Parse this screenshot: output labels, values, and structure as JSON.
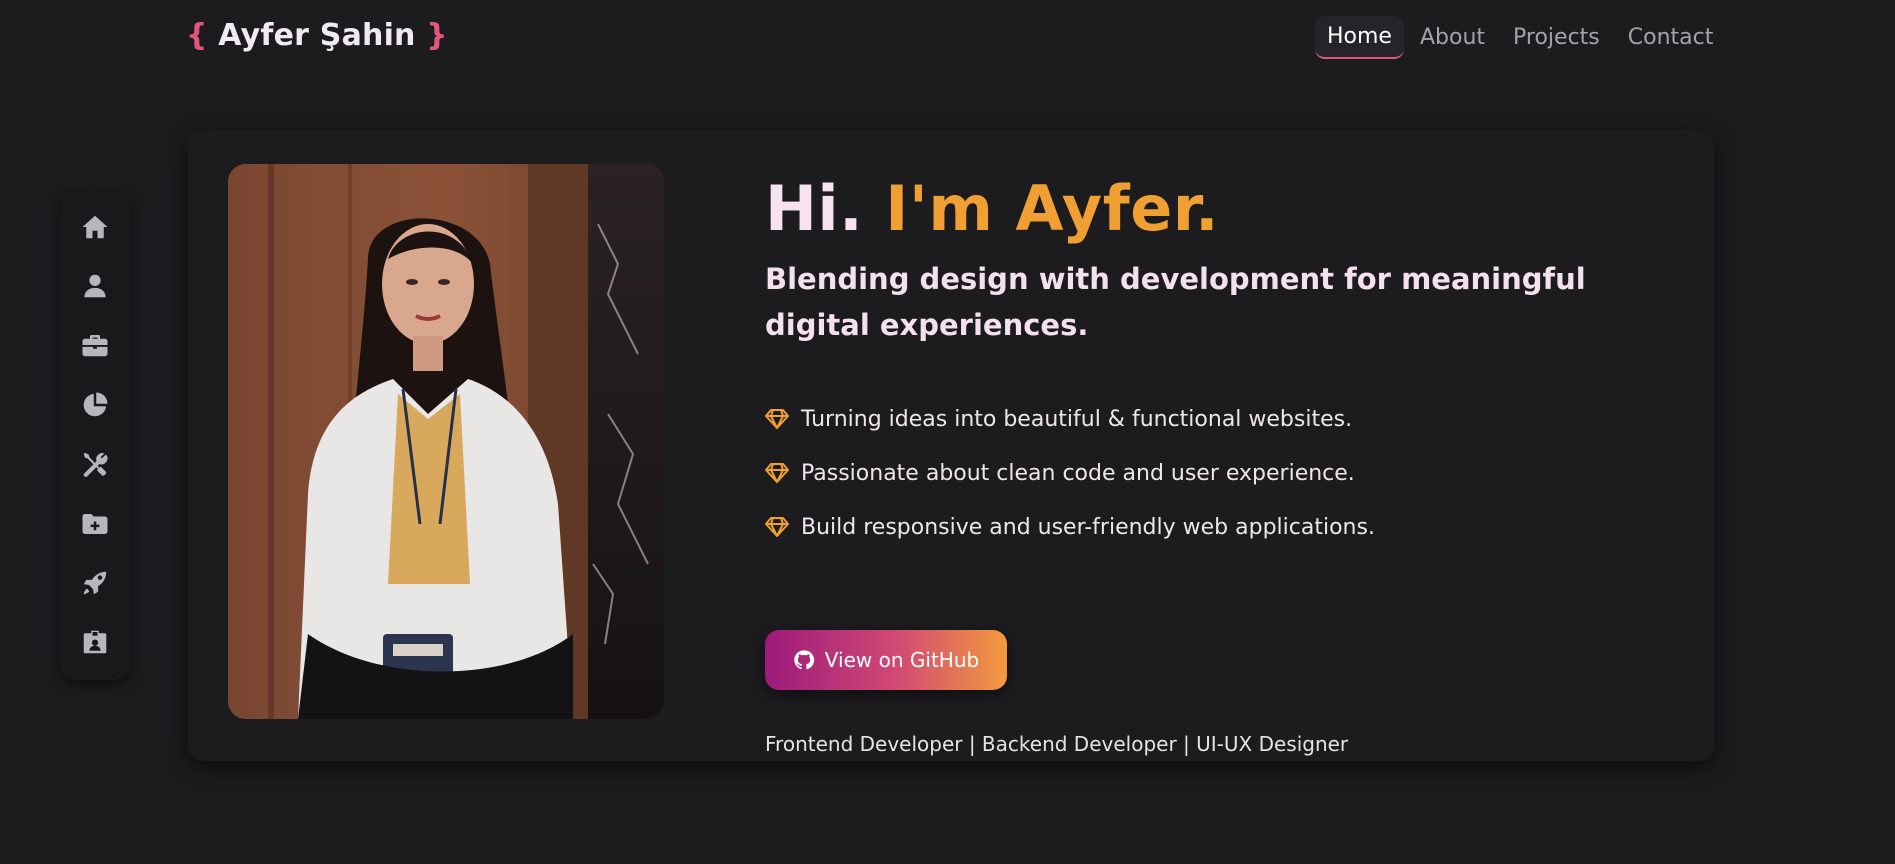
{
  "header": {
    "brand_open": "{",
    "brand_name": "Ayfer Şahin",
    "brand_close": "}",
    "nav": [
      {
        "label": "Home",
        "active": true
      },
      {
        "label": "About",
        "active": false
      },
      {
        "label": "Projects",
        "active": false
      },
      {
        "label": "Contact",
        "active": false
      }
    ]
  },
  "sidebar": {
    "icons": [
      "home-icon",
      "user-icon",
      "briefcase-icon",
      "chart-pie-icon",
      "tools-icon",
      "folder-plus-icon",
      "rocket-icon",
      "id-badge-icon"
    ]
  },
  "hero": {
    "title_prefix": "Hi.",
    "title_accent": "I'm Ayfer.",
    "subtitle": "Blending design with development for meaningful digital experiences.",
    "points": [
      "Turning ideas into beautiful & functional websites.",
      "Passionate about clean code and user experience.",
      "Build responsive and user-friendly web applications."
    ],
    "point_icon": "gem-icon",
    "github_button": "View on GitHub",
    "github_icon": "github-icon",
    "roles": "Frontend Developer | Backend Developer | UI-UX Designer"
  },
  "colors": {
    "background": "#1c1b1e",
    "brand_accent": "#e0577a",
    "title_accent": "#f0a032",
    "button_gradient": [
      "#9c1a7c",
      "#d24a74",
      "#f29a3e"
    ]
  }
}
